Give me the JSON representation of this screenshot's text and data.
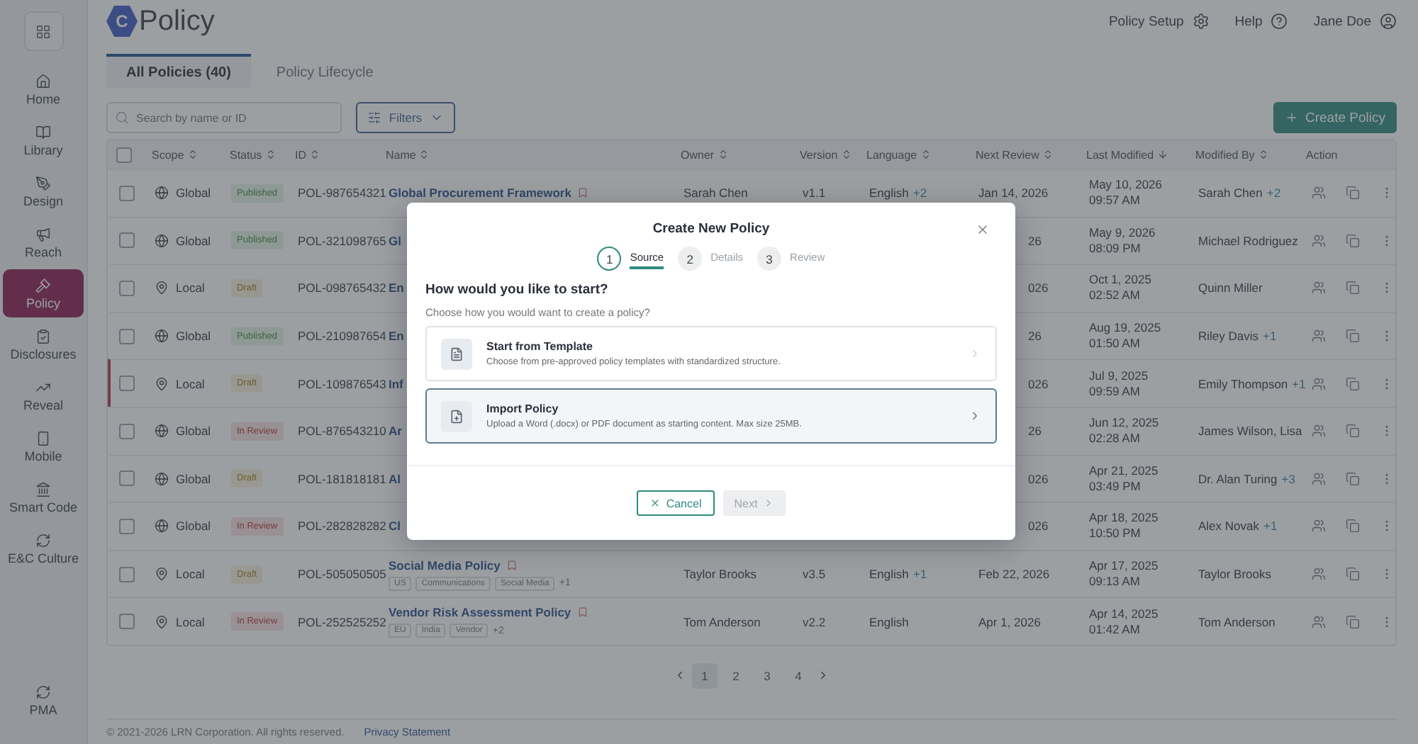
{
  "sidebar": {
    "items": [
      {
        "label": "Home",
        "kind": "home",
        "selected": false
      },
      {
        "label": "Library",
        "kind": "library",
        "selected": false
      },
      {
        "label": "Design",
        "kind": "design",
        "selected": false
      },
      {
        "label": "Reach",
        "kind": "reach",
        "selected": false
      },
      {
        "label": "Policy",
        "kind": "policy",
        "selected": true
      },
      {
        "label": "Disclosures",
        "kind": "disclosures",
        "selected": false
      },
      {
        "label": "Reveal",
        "kind": "reveal",
        "selected": false
      },
      {
        "label": "Mobile",
        "kind": "mobile",
        "selected": false
      },
      {
        "label": "Smart Code",
        "kind": "code",
        "selected": false
      },
      {
        "label": "E&C Culture",
        "kind": "culture",
        "selected": false
      }
    ],
    "bottom_item": {
      "label": "PMA",
      "kind": "culture",
      "selected": false
    }
  },
  "header": {
    "logo": {
      "mark": "C",
      "name": "Policy"
    },
    "links": [
      {
        "label": "Policy Setup",
        "kind": "settings"
      },
      {
        "label": "Help",
        "kind": "help"
      },
      {
        "label": "Jane Doe",
        "kind": "user"
      }
    ]
  },
  "tabs": [
    {
      "label": "All Policies (40)",
      "selected": true
    },
    {
      "label": "Policy Lifecycle",
      "selected": false
    }
  ],
  "toolbar": {
    "search": {
      "placeholder": "Search by name or ID"
    },
    "filters": "Filters",
    "create": "Create Policy"
  },
  "table": {
    "all_checked": false,
    "columns": [
      {
        "label": "Scope",
        "sortable": true,
        "sorted_desc": false
      },
      {
        "label": "Status",
        "sortable": true,
        "sorted_desc": false
      },
      {
        "label": "ID",
        "sortable": true,
        "sorted_desc": false
      },
      {
        "label": "Name",
        "sortable": true,
        "sorted_desc": false
      },
      {
        "label": "Owner",
        "sortable": true,
        "sorted_desc": false
      },
      {
        "label": "Version",
        "sortable": true,
        "sorted_desc": false
      },
      {
        "label": "Language",
        "sortable": true,
        "sorted_desc": false
      },
      {
        "label": "Next Review",
        "sortable": true,
        "sorted_desc": false
      },
      {
        "label": "Last Modified",
        "sortable": true,
        "sorted_desc": true
      },
      {
        "label": "Modified By",
        "sortable": true,
        "sorted_desc": false
      },
      {
        "label": "Action",
        "sortable": false,
        "sorted_desc": false
      }
    ],
    "rows": [
      {
        "checked": false,
        "highlighted": false,
        "under_dialog": false,
        "scope": {
          "label": "Global",
          "kind": "global"
        },
        "status": {
          "label": "Published",
          "kind": "published"
        },
        "id": "POL-987654321",
        "name": "Global Procurement Framework",
        "flag": true,
        "owner": "Sarah Chen",
        "version": "v1.1",
        "language": "English",
        "language_extra": "+2",
        "next_review": "Jan 14, 2026",
        "modified_date": "May 10, 2026",
        "modified_time": "09:57 AM",
        "modified_by": "Sarah Chen",
        "modified_extra": "+2"
      },
      {
        "checked": false,
        "highlighted": false,
        "under_dialog": true,
        "scope": {
          "label": "Global",
          "kind": "global"
        },
        "status": {
          "label": "Published",
          "kind": "published"
        },
        "id": "POL-321098765",
        "name": "Gl",
        "flag": false,
        "next_review": "26",
        "modified_date": "May 9, 2026",
        "modified_time": "08:09 PM",
        "modified_by": "Michael Rodriguez"
      },
      {
        "checked": false,
        "highlighted": false,
        "under_dialog": true,
        "scope": {
          "label": "Local",
          "kind": "local"
        },
        "status": {
          "label": "Draft",
          "kind": "draft"
        },
        "id": "POL-098765432",
        "name": "En",
        "flag": false,
        "next_review": "026",
        "modified_date": "Oct 1, 2025",
        "modified_time": "02:52 AM",
        "modified_by": "Quinn Miller"
      },
      {
        "checked": false,
        "highlighted": false,
        "under_dialog": true,
        "scope": {
          "label": "Global",
          "kind": "global"
        },
        "status": {
          "label": "Published",
          "kind": "published"
        },
        "id": "POL-210987654",
        "name": "En",
        "flag": false,
        "next_review": "26",
        "modified_date": "Aug 19, 2025",
        "modified_time": "01:50 AM",
        "modified_by": "Riley Davis",
        "modified_extra": "+1"
      },
      {
        "checked": false,
        "highlighted": true,
        "under_dialog": true,
        "scope": {
          "label": "Local",
          "kind": "local"
        },
        "status": {
          "label": "Draft",
          "kind": "draft"
        },
        "id": "POL-109876543",
        "name": "Inf",
        "flag": false,
        "next_review": "026",
        "modified_date": "Jul 9, 2025",
        "modified_time": "09:59 AM",
        "modified_by": "Emily Thompson",
        "modified_extra": "+1"
      },
      {
        "checked": false,
        "highlighted": false,
        "under_dialog": true,
        "scope": {
          "label": "Global",
          "kind": "global"
        },
        "status": {
          "label": "In Review",
          "kind": "review"
        },
        "id": "POL-876543210",
        "name": "Ar",
        "flag": false,
        "next_review": "26",
        "modified_date": "Jun 12, 2025",
        "modified_time": "02:28 AM",
        "modified_by": "James Wilson, Lisa"
      },
      {
        "checked": false,
        "highlighted": false,
        "under_dialog": true,
        "scope": {
          "label": "Global",
          "kind": "global"
        },
        "status": {
          "label": "Draft",
          "kind": "draft"
        },
        "id": "POL-181818181",
        "name": "Al",
        "flag": false,
        "next_review": "026",
        "modified_date": "Apr 21, 2025",
        "modified_time": "03:49 PM",
        "modified_by": "Dr. Alan Turing",
        "modified_extra": "+3"
      },
      {
        "checked": false,
        "highlighted": false,
        "under_dialog": true,
        "scope": {
          "label": "Global",
          "kind": "global"
        },
        "status": {
          "label": "In Review",
          "kind": "review"
        },
        "id": "POL-282828282",
        "name": "Cl",
        "flag": false,
        "next_review": "026",
        "modified_date": "Apr 18, 2025",
        "modified_time": "10:50 PM",
        "modified_by": "Alex Novak",
        "modified_extra": "+1"
      },
      {
        "checked": false,
        "highlighted": false,
        "under_dialog": false,
        "scope": {
          "label": "Local",
          "kind": "local"
        },
        "status": {
          "label": "Draft",
          "kind": "draft"
        },
        "id": "POL-505050505",
        "name": "Social Media Policy",
        "flag": true,
        "tags": [
          "US",
          "Communications",
          "Social Media"
        ],
        "tags_more": "+1",
        "owner": "Taylor Brooks",
        "version": "v3.5",
        "language": "English",
        "language_extra": "+1",
        "next_review": "Feb 22, 2026",
        "modified_date": "Apr 17, 2025",
        "modified_time": "09:13 AM",
        "modified_by": "Taylor Brooks"
      },
      {
        "checked": false,
        "highlighted": false,
        "under_dialog": false,
        "scope": {
          "label": "Local",
          "kind": "local"
        },
        "status": {
          "label": "In Review",
          "kind": "review"
        },
        "id": "POL-252525252",
        "name": "Vendor Risk Assessment Policy",
        "flag": true,
        "tags": [
          "EU",
          "India",
          "Vendor"
        ],
        "tags_more": "+2",
        "owner": "Tom Anderson",
        "version": "v2.2",
        "language": "English",
        "next_review": "Apr 1, 2026",
        "modified_date": "Apr 14, 2025",
        "modified_time": "01:42 AM",
        "modified_by": "Tom Anderson"
      }
    ]
  },
  "pagination": [
    {
      "label": "1",
      "selected": true
    },
    {
      "label": "2",
      "selected": false
    },
    {
      "label": "3",
      "selected": false
    },
    {
      "label": "4",
      "selected": false
    }
  ],
  "footer": {
    "copyright": "© 2021-2026 LRN Corporation. All rights reserved.",
    "link": "Privacy Statement"
  },
  "dialog": {
    "title": "Create New Policy",
    "steps": [
      {
        "number": "1",
        "label": "Source",
        "selected": true
      },
      {
        "number": "2",
        "label": "Details",
        "selected": false
      },
      {
        "number": "3",
        "label": "Review",
        "selected": false
      }
    ],
    "heading": "How would you like to start?",
    "subheading": "Choose how you would want to create a policy?",
    "options": [
      {
        "title": "Start from Template",
        "description": "Choose from pre-approved policy templates with standardized structure.",
        "kind": "template",
        "selected": false
      },
      {
        "title": "Import Policy",
        "description": "Upload a Word (.docx) or PDF document as starting content. Max size 25MB.",
        "kind": "import",
        "selected": true
      }
    ],
    "cancel": "Cancel",
    "next": {
      "label": "Next",
      "disabled": true
    }
  }
}
